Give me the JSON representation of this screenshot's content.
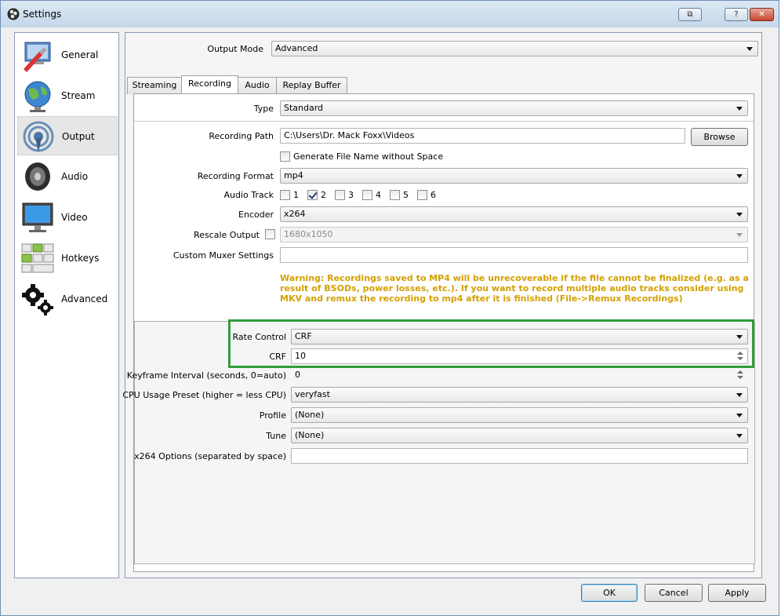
{
  "window": {
    "title": "Settings"
  },
  "titlebar": {
    "restore_glyph": "⧉",
    "help_glyph": "?",
    "close_glyph": "✕"
  },
  "sidebar": {
    "items": [
      {
        "label": "General",
        "icon": "general-icon"
      },
      {
        "label": "Stream",
        "icon": "stream-globe-icon"
      },
      {
        "label": "Output",
        "icon": "output-broadcast-icon",
        "active": true
      },
      {
        "label": "Audio",
        "icon": "speaker-icon"
      },
      {
        "label": "Video",
        "icon": "monitor-icon"
      },
      {
        "label": "Hotkeys",
        "icon": "keyboard-icon"
      },
      {
        "label": "Advanced",
        "icon": "gears-icon"
      }
    ]
  },
  "output": {
    "mode_label": "Output Mode",
    "mode_value": "Advanced",
    "tabs": [
      "Streaming",
      "Recording",
      "Audio",
      "Replay Buffer"
    ],
    "active_tab": "Recording"
  },
  "recording": {
    "type_label": "Type",
    "type_value": "Standard",
    "path_label": "Recording Path",
    "path_value": "C:\\Users\\Dr. Mack Foxx\\Videos",
    "browse_label": "Browse",
    "gen_filename_label": "Generate File Name without Space",
    "gen_filename_checked": false,
    "format_label": "Recording Format",
    "format_value": "mp4",
    "audio_track_label": "Audio Track",
    "audio_tracks": [
      {
        "label": "1",
        "checked": false
      },
      {
        "label": "2",
        "checked": true
      },
      {
        "label": "3",
        "checked": false
      },
      {
        "label": "4",
        "checked": false
      },
      {
        "label": "5",
        "checked": false
      },
      {
        "label": "6",
        "checked": false
      }
    ],
    "encoder_label": "Encoder",
    "encoder_value": "x264",
    "rescale_label": "Rescale Output",
    "rescale_value": "1680x1050",
    "muxer_label": "Custom Muxer Settings",
    "muxer_value": "",
    "warning": "Warning: Recordings saved to MP4 will be unrecoverable if the file cannot be finalized (e.g. as a result of BSODs, power losses, etc.). If you want to record multiple audio tracks consider using MKV and remux the recording to mp4 after it is finished (File->Remux Recordings)"
  },
  "encoder_settings": {
    "rate_control_label": "Rate Control",
    "rate_control_value": "CRF",
    "crf_label": "CRF",
    "crf_value": "10",
    "keyframe_label": "Keyframe Interval (seconds, 0=auto)",
    "keyframe_value": "0",
    "cpu_preset_label": "CPU Usage Preset (higher = less CPU)",
    "cpu_preset_value": "veryfast",
    "profile_label": "Profile",
    "profile_value": "(None)",
    "tune_label": "Tune",
    "tune_value": "(None)",
    "x264_options_label": "x264 Options (separated by space)",
    "x264_options_value": ""
  },
  "footer": {
    "ok_label": "OK",
    "cancel_label": "Cancel",
    "apply_label": "Apply"
  },
  "colors": {
    "warning": "#d4a000",
    "highlight": "#2f9e3b"
  }
}
